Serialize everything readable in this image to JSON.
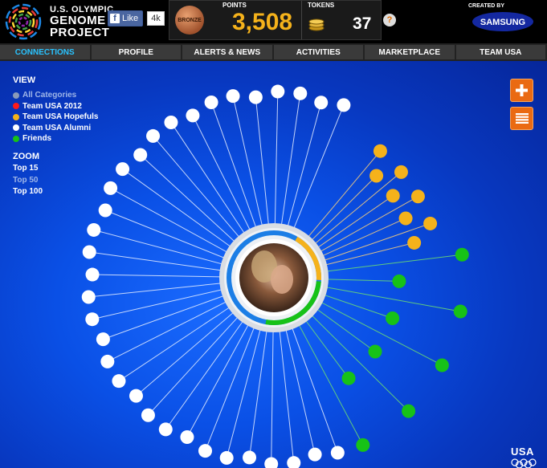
{
  "brand": {
    "line1": "U.S. OLYMPIC",
    "line2": "GENOME",
    "line3": "PROJECT",
    "icon": "genome-logo-icon"
  },
  "facebook": {
    "like_label": "Like",
    "count": "4k",
    "icon": "facebook-f-icon"
  },
  "score": {
    "medal_label": "BRONZE",
    "points_label": "POINTS",
    "points_value": "3,508",
    "tokens_label": "TOKENS",
    "tokens_value": "37",
    "help_label": "?"
  },
  "sponsor": {
    "created_by": "CREATED BY",
    "name": "SAMSUNG"
  },
  "nav": {
    "items": [
      "CONNECTIONS",
      "PROFILE",
      "ALERTS & NEWS",
      "ACTIVITIES",
      "MARKETPLACE",
      "TEAM USA"
    ],
    "active_index": 0
  },
  "view": {
    "title": "VIEW",
    "categories": [
      {
        "label": "All Categories",
        "color": "#8a9ab8"
      },
      {
        "label": "Team USA 2012",
        "color": "#ff1a1a"
      },
      {
        "label": "Team USA Hopefuls",
        "color": "#f5b21b"
      },
      {
        "label": "Team USA Alumni",
        "color": "#ffffff"
      },
      {
        "label": "Friends",
        "color": "#17c217"
      }
    ]
  },
  "zoom": {
    "title": "ZOOM",
    "options": [
      "Top 15",
      "Top 50",
      "Top 100"
    ],
    "selected_index": 1
  },
  "right_buttons": {
    "add_icon": "plus-icon",
    "list_icon": "list-icon"
  },
  "colors": {
    "accent_orange": "#ea6a12",
    "hopeful": "#f5b21b",
    "friend": "#17c217",
    "alumni": "#ffffff",
    "active_nav": "#29c3ff",
    "points": "#f5b21b"
  },
  "network": {
    "center_photo": "profile-photo",
    "hopefuls_count": 8,
    "friends_count": 9,
    "alumni_count": 33
  },
  "footer": {
    "usa_label": "USA"
  }
}
